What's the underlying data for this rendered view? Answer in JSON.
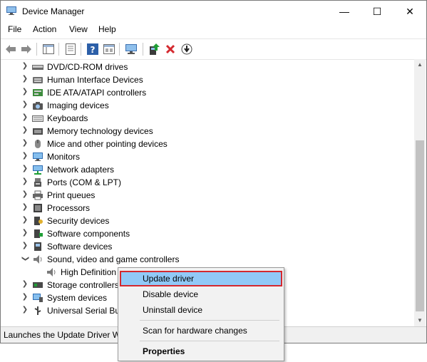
{
  "window": {
    "title": "Device Manager",
    "controls": {
      "minimize": "—",
      "maximize": "☐",
      "close": "✕"
    }
  },
  "menu": [
    "File",
    "Action",
    "View",
    "Help"
  ],
  "toolbar": {
    "icons": [
      "back-icon",
      "forward-icon",
      "show-hide-tree-icon",
      "properties-icon",
      "help-icon",
      "view-icon",
      "monitor-icon",
      "update-driver-icon",
      "uninstall-icon",
      "install-icon"
    ]
  },
  "tree": {
    "items": [
      {
        "label": "DVD/CD-ROM drives",
        "icon": "dvd-icon",
        "expanded": false
      },
      {
        "label": "Human Interface Devices",
        "icon": "hid-icon",
        "expanded": false
      },
      {
        "label": "IDE ATA/ATAPI controllers",
        "icon": "ide-icon",
        "expanded": false
      },
      {
        "label": "Imaging devices",
        "icon": "camera-icon",
        "expanded": false
      },
      {
        "label": "Keyboards",
        "icon": "keyboard-icon",
        "expanded": false
      },
      {
        "label": "Memory technology devices",
        "icon": "memory-icon",
        "expanded": false
      },
      {
        "label": "Mice and other pointing devices",
        "icon": "mouse-icon",
        "expanded": false
      },
      {
        "label": "Monitors",
        "icon": "monitor-icon",
        "expanded": false
      },
      {
        "label": "Network adapters",
        "icon": "network-icon",
        "expanded": false
      },
      {
        "label": "Ports (COM & LPT)",
        "icon": "port-icon",
        "expanded": false
      },
      {
        "label": "Print queues",
        "icon": "printer-icon",
        "expanded": false
      },
      {
        "label": "Processors",
        "icon": "cpu-icon",
        "expanded": false
      },
      {
        "label": "Security devices",
        "icon": "security-icon",
        "expanded": false
      },
      {
        "label": "Software components",
        "icon": "component-icon",
        "expanded": false
      },
      {
        "label": "Software devices",
        "icon": "software-icon",
        "expanded": false
      },
      {
        "label": "Sound, video and game controllers",
        "icon": "speaker-icon",
        "expanded": true
      },
      {
        "label": "High Definition",
        "icon": "speaker-icon",
        "child": true
      },
      {
        "label": "Storage controllers",
        "icon": "storage-icon",
        "expanded": false
      },
      {
        "label": "System devices",
        "icon": "system-icon",
        "expanded": false
      },
      {
        "label": "Universal Serial Bus",
        "icon": "usb-icon",
        "expanded": false
      }
    ]
  },
  "context_menu": {
    "items": [
      "Update driver",
      "Disable device",
      "Uninstall device",
      "Scan for hardware changes",
      "Properties"
    ]
  },
  "status": "Launches the Update Driver Wi",
  "colors": {
    "highlight": "#91c9f7",
    "highlight_border": "#d4292f",
    "uninstall_red": "#d4292f"
  }
}
